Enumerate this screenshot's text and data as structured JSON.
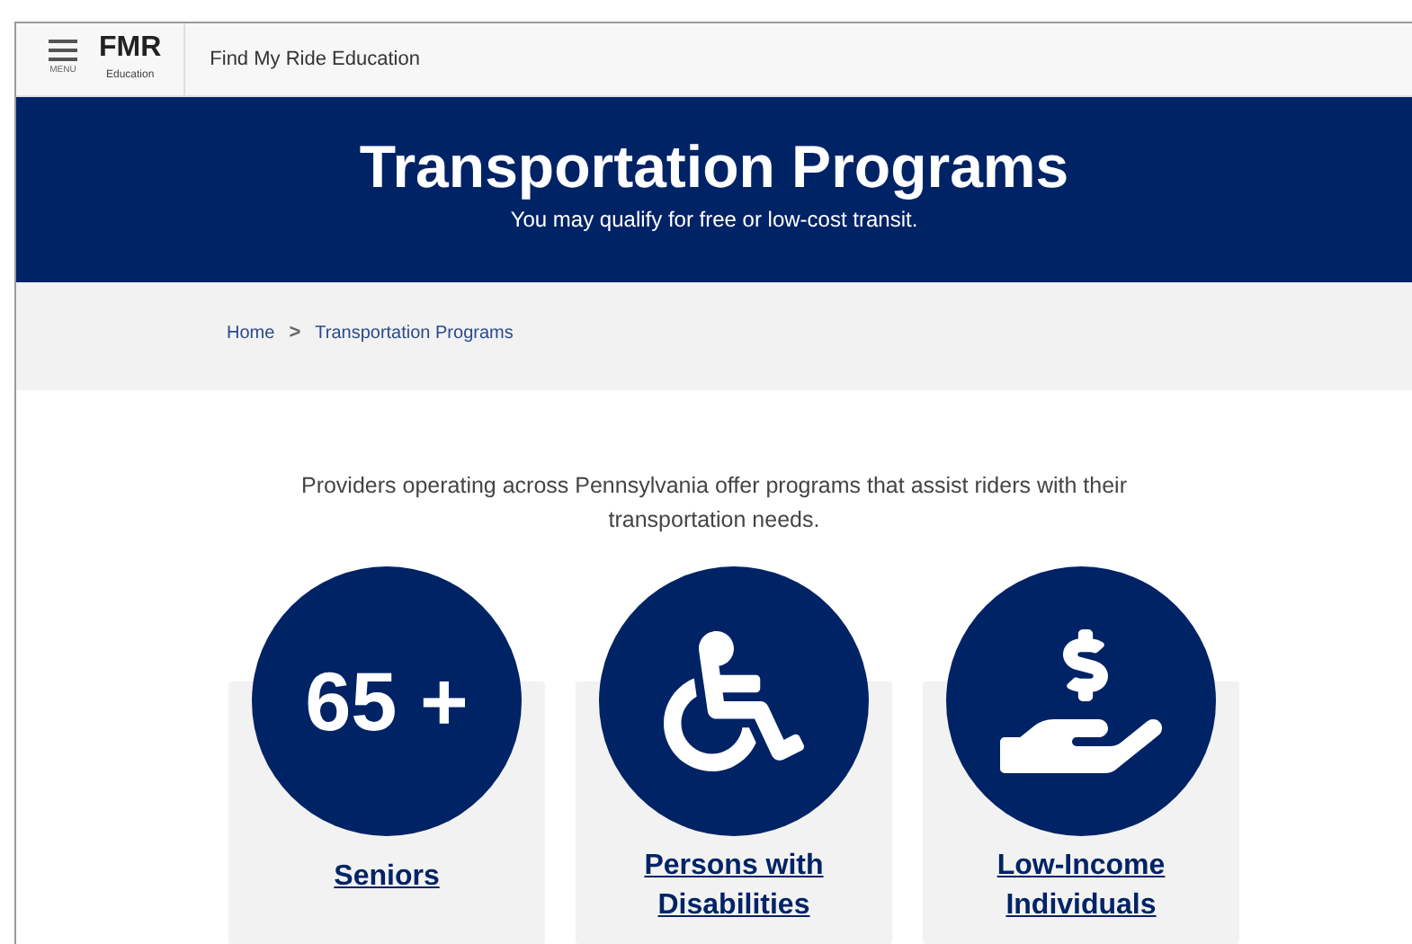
{
  "header": {
    "menu_label": "MENU",
    "logo": "FMR",
    "logo_subtitle": "Education",
    "site_title": "Find My Ride Education"
  },
  "banner": {
    "title": "Transportation Programs",
    "subtitle": "You may qualify for free or low-cost transit."
  },
  "breadcrumb": [
    {
      "label": "Home"
    },
    {
      "label": "Transportation Programs"
    }
  ],
  "breadcrumb_separator": ">",
  "intro": "Providers operating across Pennsylvania offer programs that assist riders with their transportation needs.",
  "programs": [
    {
      "kind": "number",
      "badge": "65 +",
      "label": "Seniors"
    },
    {
      "kind": "wheelchair",
      "label": "Persons with Disabilities"
    },
    {
      "kind": "money",
      "label": "Low-Income Individuals"
    }
  ]
}
